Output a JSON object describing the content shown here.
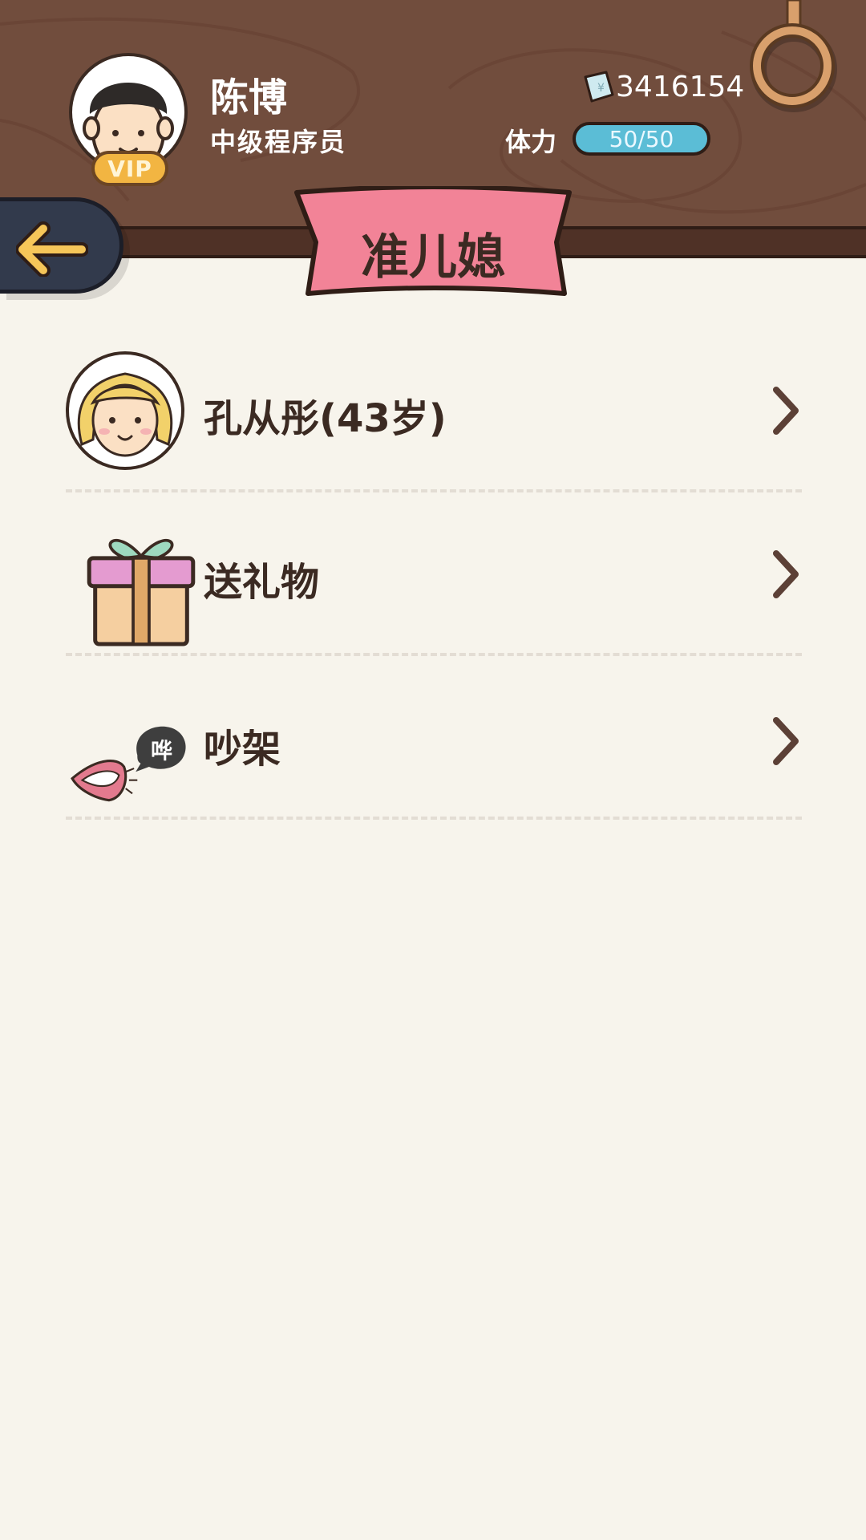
{
  "player": {
    "name": "陈博",
    "title": "中级程序员",
    "vip_label": "VIP",
    "money": "3416154",
    "stamina_label": "体力",
    "stamina": "50/50",
    "stamina_fraction": 1.0
  },
  "page": {
    "title": "准儿媳"
  },
  "menu": [
    {
      "label": "孔从彤(43岁)",
      "icon": "girl-avatar-icon"
    },
    {
      "label": "送礼物",
      "icon": "gift-icon"
    },
    {
      "label": "吵架",
      "icon": "shouting-mouth-icon"
    }
  ],
  "icons": {
    "speech_bubble_text": "哗"
  },
  "colors": {
    "header_wood": "#714d3d",
    "banner_pink": "#f28397",
    "stamina_blue": "#5bbdd6",
    "back_button": "#323a4c",
    "arrow_yellow": "#f6c659",
    "background": "#f7f4ec"
  }
}
